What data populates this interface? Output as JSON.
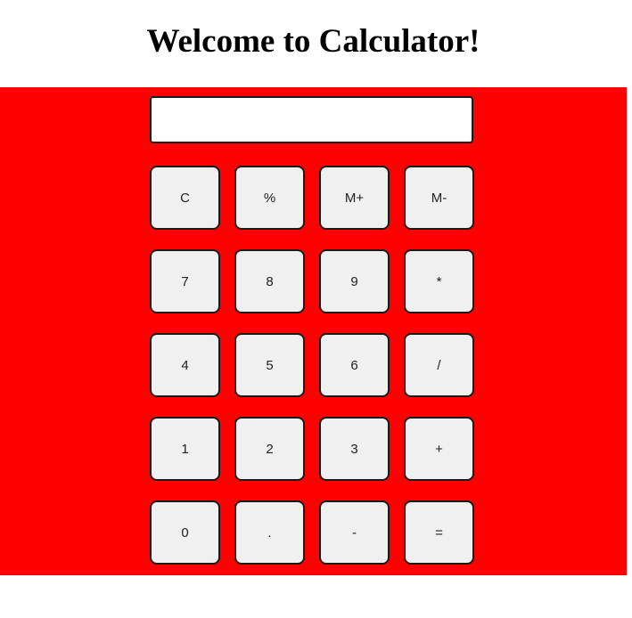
{
  "header": {
    "title": "Welcome to Calculator!"
  },
  "display": {
    "value": ""
  },
  "keys": [
    {
      "label": "C",
      "name": "clear"
    },
    {
      "label": "%",
      "name": "percent"
    },
    {
      "label": "M+",
      "name": "memory-add"
    },
    {
      "label": "M-",
      "name": "memory-subtract"
    },
    {
      "label": "7",
      "name": "digit-7"
    },
    {
      "label": "8",
      "name": "digit-8"
    },
    {
      "label": "9",
      "name": "digit-9"
    },
    {
      "label": "*",
      "name": "multiply"
    },
    {
      "label": "4",
      "name": "digit-4"
    },
    {
      "label": "5",
      "name": "digit-5"
    },
    {
      "label": "6",
      "name": "digit-6"
    },
    {
      "label": "/",
      "name": "divide"
    },
    {
      "label": "1",
      "name": "digit-1"
    },
    {
      "label": "2",
      "name": "digit-2"
    },
    {
      "label": "3",
      "name": "digit-3"
    },
    {
      "label": "+",
      "name": "add"
    },
    {
      "label": "0",
      "name": "digit-0"
    },
    {
      "label": ".",
      "name": "decimal-point"
    },
    {
      "label": "-",
      "name": "subtract"
    },
    {
      "label": "=",
      "name": "equals"
    }
  ],
  "colors": {
    "panel_background": "#ff0000",
    "key_background": "#f0f0f0",
    "display_background": "#ffffff"
  }
}
